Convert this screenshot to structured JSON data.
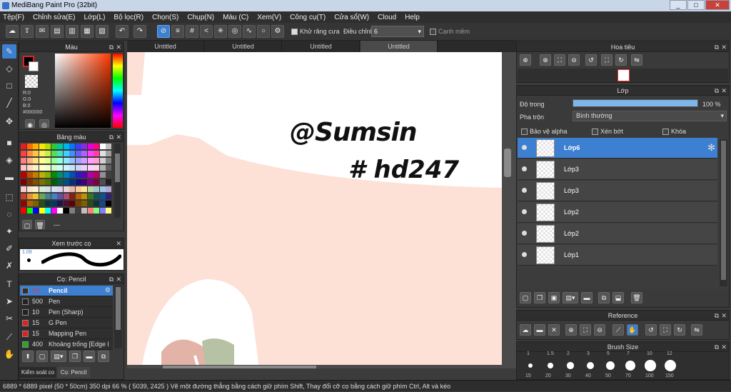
{
  "app": {
    "title": "MediBang Paint Pro (32bit)"
  },
  "window_buttons": [
    "_",
    "□",
    "✕"
  ],
  "menu": [
    "Tệp(F)",
    "Chỉnh sửa(E)",
    "Lớp(L)",
    "Bộ lọc(R)",
    "Chọn(S)",
    "Chụp(N)",
    "Màu (C)",
    "Xem(V)",
    "Công cụ(T)",
    "Cửa sổ(W)",
    "Cloud",
    "Help"
  ],
  "toolbar": {
    "antialias_label": "Khử răng cưa",
    "correction_label": "Điều chỉnh",
    "correction_value": "6",
    "smooth_label": "Cạnh mềm"
  },
  "tabs": [
    "Untitled",
    "Untitled",
    "Untitled",
    "Untitled"
  ],
  "color_panel": {
    "title": "Màu",
    "r": "R:0",
    "g": "G:0",
    "b": "B:0",
    "hex": "#000000"
  },
  "palette_panel": {
    "title": "Bảng màu",
    "footer": "---"
  },
  "brush_preview": {
    "title": "Xem trước cọ",
    "size": "1.09"
  },
  "brush_panel": {
    "title": "Cọ: Pencil",
    "items": [
      {
        "size": "15",
        "name": "Pencil",
        "color": "#e02020"
      },
      {
        "size": "500",
        "name": "Pen",
        "color": "#222222"
      },
      {
        "size": "10",
        "name": "Pen (Sharp)",
        "color": "#222222"
      },
      {
        "size": "15",
        "name": "G Pen",
        "color": "#e02020"
      },
      {
        "size": "15",
        "name": "Mapping Pen",
        "color": "#e02020"
      },
      {
        "size": "400",
        "name": "Khoảng trống [Edge l",
        "color": "#22aa22"
      }
    ],
    "bottom_tabs": [
      "Kiểm soát co",
      "Cọ: Pencil"
    ]
  },
  "canvas_text": {
    "line1": "@Sumsin",
    "line2": "# hd247"
  },
  "navigator": {
    "title": "Hoa tiêu"
  },
  "layer_panel": {
    "title": "Lớp",
    "opacity_label": "Độ trong",
    "opacity_value": "100 %",
    "opacity": 1.0,
    "blend_label": "Pha trộn",
    "blend_value": "Bình thường",
    "protect_alpha": "Bảo vệ alpha",
    "clip": "Xén bớt",
    "lock": "Khóa",
    "layers": [
      "Lớp6",
      "Lớp3",
      "Lớp3",
      "Lớp2",
      "Lớp2",
      "Lớp1"
    ]
  },
  "reference_panel": {
    "title": "Reference"
  },
  "brush_size_panel": {
    "title": "Brush Size",
    "ticks": [
      "1",
      "1.5",
      "2",
      "3",
      "5",
      "7",
      "10",
      "12"
    ],
    "values": [
      "15",
      "20",
      "30",
      "40",
      "50",
      "70",
      "100",
      "150"
    ]
  },
  "status": {
    "text": "6889 * 6889 pixel  (50 * 50cm)  350 dpi  66 %  ( 5039, 2425 )  Vẽ một đường thẳng bằng cách giữ phím Shift, Thay đổi cỡ cọ bằng cách giữ phím Ctrl, Alt và kéo"
  }
}
